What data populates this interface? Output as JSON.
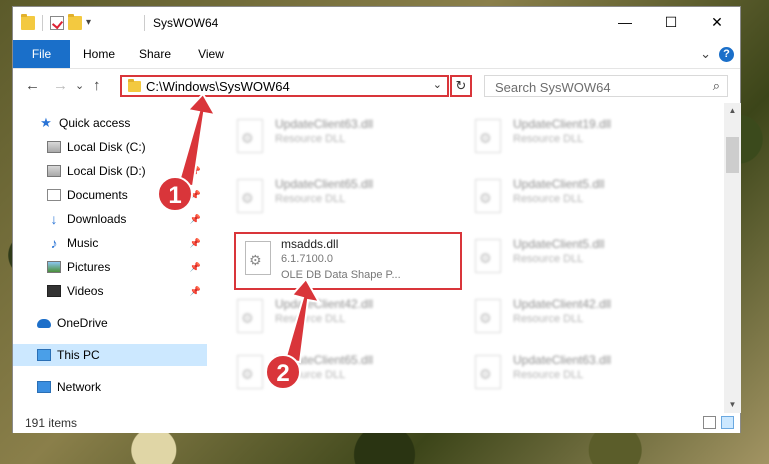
{
  "window": {
    "title": "SysWOW64",
    "controls": {
      "minimize": "—",
      "maximize": "☐",
      "close": "✕"
    }
  },
  "ribbon": {
    "tabs": [
      "File",
      "Home",
      "Share",
      "View"
    ],
    "expand": "⌄",
    "help": "?"
  },
  "nav": {
    "back": "←",
    "forward": "→",
    "recent": "⌄",
    "up": "↑",
    "address": "C:\\Windows\\SysWOW64",
    "address_dropdown": "⌄",
    "refresh": "↻",
    "search_placeholder": "Search SysWOW64",
    "search_icon": "⌕"
  },
  "sidebar": {
    "items": [
      {
        "label": "Quick access",
        "icon": "star-icon",
        "pinned": false
      },
      {
        "label": "Local Disk (C:)",
        "icon": "drive-icon",
        "pinned": true
      },
      {
        "label": "Local Disk (D:)",
        "icon": "drive-icon",
        "pinned": true
      },
      {
        "label": "Documents",
        "icon": "documents-icon",
        "pinned": true
      },
      {
        "label": "Downloads",
        "icon": "downloads-icon",
        "pinned": true
      },
      {
        "label": "Music",
        "icon": "music-icon",
        "pinned": true
      },
      {
        "label": "Pictures",
        "icon": "pictures-icon",
        "pinned": true
      },
      {
        "label": "Videos",
        "icon": "videos-icon",
        "pinned": true
      },
      {
        "label": "OneDrive",
        "icon": "onedrive-icon",
        "pinned": false
      },
      {
        "label": "This PC",
        "icon": "this-pc-icon",
        "pinned": false,
        "selected": true
      },
      {
        "label": "Network",
        "icon": "network-icon",
        "pinned": false
      }
    ],
    "pin_glyph": "📌"
  },
  "files": {
    "left": [
      {
        "name": "UpdateClient63.dll",
        "desc": "Resource DLL"
      },
      {
        "name": "UpdateClient65.dll",
        "desc": "Resource DLL"
      },
      {
        "name": "msadds.dll",
        "version": "6.1.7100.0",
        "desc": "OLE DB Data Shape P...",
        "highlighted": true
      },
      {
        "name": "UpdateClient42.dll",
        "desc": "Resource DLL"
      },
      {
        "name": "UpdateClient65.dll",
        "desc": "Resource DLL"
      }
    ],
    "right": [
      {
        "name": "UpdateClient19.dll",
        "desc": "Resource DLL"
      },
      {
        "name": "UpdateClient5.dll",
        "desc": "Resource DLL"
      },
      {
        "name": "UpdateClient5.dll",
        "desc": "Resource DLL"
      },
      {
        "name": "UpdateClient42.dll",
        "desc": "Resource DLL"
      },
      {
        "name": "UpdateClient63.dll",
        "desc": "Resource DLL"
      }
    ]
  },
  "scrollbar": {
    "up": "▲",
    "down": "▼"
  },
  "status": {
    "items_count": "191 items"
  },
  "annotations": {
    "step1": "1",
    "step2": "2"
  },
  "colors": {
    "accent": "#1a6fc9",
    "highlight": "#d9353a",
    "selection": "#cce8ff"
  }
}
